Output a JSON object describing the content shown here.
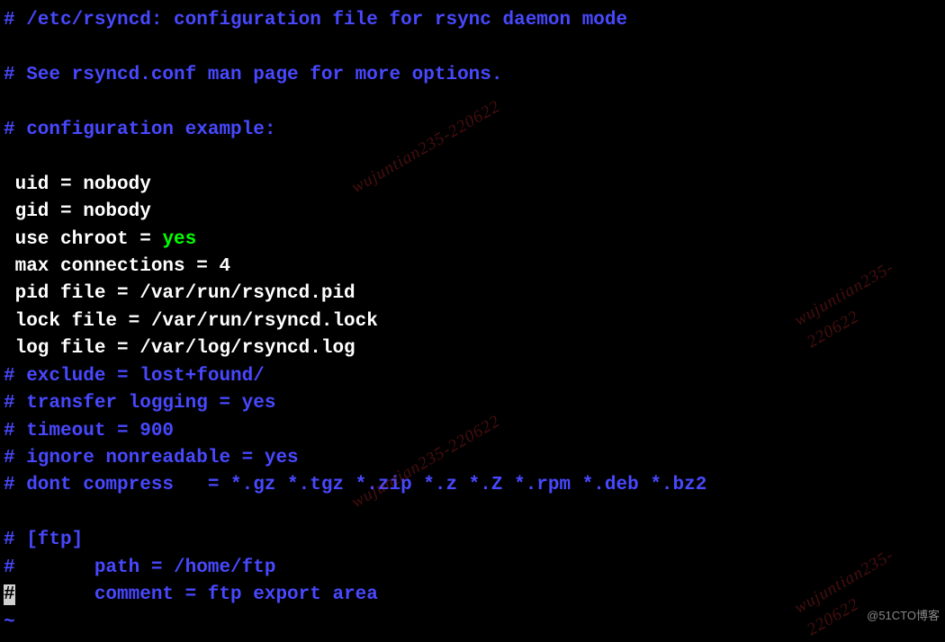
{
  "lines": [
    {
      "type": "comment",
      "text": "# /etc/rsyncd: configuration file for rsync daemon mode"
    },
    {
      "type": "blank",
      "text": ""
    },
    {
      "type": "comment",
      "text": "# See rsyncd.conf man page for more options."
    },
    {
      "type": "blank",
      "text": ""
    },
    {
      "type": "comment",
      "text": "# configuration example:"
    },
    {
      "type": "blank",
      "text": ""
    },
    {
      "type": "config",
      "prefix": " uid = ",
      "value": "nobody"
    },
    {
      "type": "config",
      "prefix": " gid = ",
      "value": "nobody"
    },
    {
      "type": "config-green",
      "prefix": " use chroot = ",
      "value": "yes"
    },
    {
      "type": "config",
      "prefix": " max connections = ",
      "value": "4"
    },
    {
      "type": "config",
      "prefix": " pid file = ",
      "value": "/var/run/rsyncd.pid"
    },
    {
      "type": "config",
      "prefix": " lock file = ",
      "value": "/var/run/rsyncd.lock"
    },
    {
      "type": "config",
      "prefix": " log file = ",
      "value": "/var/log/rsyncd.log"
    },
    {
      "type": "comment",
      "text": "# exclude = lost+found/"
    },
    {
      "type": "comment",
      "text": "# transfer logging = yes"
    },
    {
      "type": "comment",
      "text": "# timeout = 900"
    },
    {
      "type": "comment",
      "text": "# ignore nonreadable = yes"
    },
    {
      "type": "comment",
      "text": "# dont compress   = *.gz *.tgz *.zip *.z *.Z *.rpm *.deb *.bz2"
    },
    {
      "type": "blank",
      "text": ""
    },
    {
      "type": "comment",
      "text": "# [ftp]"
    },
    {
      "type": "comment",
      "text": "#       path = /home/ftp"
    },
    {
      "type": "cursor-comment",
      "cursor": "#",
      "rest": "       comment = ftp export area"
    },
    {
      "type": "tilde",
      "text": "~"
    }
  ],
  "watermark": "wujuntian235-220622",
  "attribution": "@51CTO博客"
}
